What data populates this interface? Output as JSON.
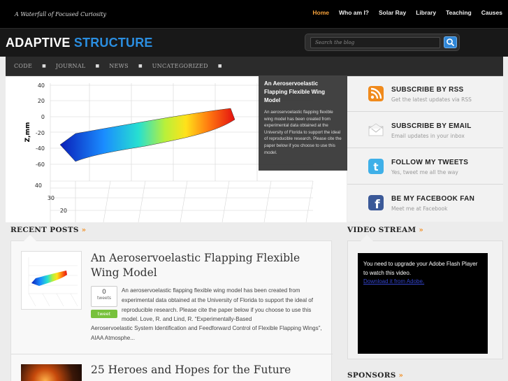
{
  "site": {
    "tagline": "A Waterfall of Focused Curiosity",
    "brand_part1": "ADAPTIVE",
    "brand_part2": "STRUCTURE"
  },
  "topnav": [
    "Home",
    "Who am I?",
    "Solar Ray",
    "Library",
    "Teaching",
    "Causes"
  ],
  "search": {
    "placeholder": "Search the blog",
    "button_icon": "search-icon"
  },
  "categories": [
    "CODE",
    "JOURNAL",
    "NEWS",
    "UNCATEGORIZED"
  ],
  "featured": {
    "title": "An Aeroservoelastic Flapping Flexible Wing Model",
    "body": "An aeroservoelastic flapping flexible wing model has been created from experimental data obtained at the University of Florida to support the ideal of reproducible research.  Please cite the paper below if you choose to use this model.",
    "plot_ylabel": "Z,mm",
    "plot_z_ticks": [
      "40",
      "20",
      "0",
      "-20",
      "-40",
      "-60"
    ],
    "plot_y_ticks": [
      "40",
      "30",
      "20"
    ]
  },
  "subscribe": [
    {
      "title": "SUBSCRIBE BY RSS",
      "subtitle": "Get the latest updates via RSS",
      "icon": "rss-icon",
      "color": "#f08a1c"
    },
    {
      "title": "SUBSCRIBE BY EMAIL",
      "subtitle": "Email updates in your inbox",
      "icon": "email-icon",
      "color": "#ffffff"
    },
    {
      "title": "FOLLOW MY TWEETS",
      "subtitle": "Yes, tweet me all the way",
      "icon": "twitter-icon",
      "color": "#3fb0e8"
    },
    {
      "title": "BE MY FACEBOOK FAN",
      "subtitle": "Meet me at Facebook",
      "icon": "facebook-icon",
      "color": "#3b5998"
    }
  ],
  "recent_posts": {
    "heading": "RECENT POSTS",
    "arrow": "»",
    "posts": [
      {
        "title": "An Aeroservoelastic Flapping Flexible Wing Model",
        "tweet_count": "0",
        "tweet_count_label": "tweets",
        "tweet_button": "tweet",
        "excerpt_a": "An aeroservoelastic flapping flexible wing model has been created from experimental data obtained at the University of Florida to support the ideal of reproducible research.  Please cite the paper below if you choose to use this model. Love, R. and Lind, R. “Experimentally-Based",
        "excerpt_b": "Aeroservoelastic System Identification and Feedforward Control of Flexible Flapping Wings”, AIAA Atmosphe..."
      },
      {
        "title": "25 Heroes and Hopes for the Future"
      }
    ]
  },
  "video": {
    "heading": "VIDEO STREAM",
    "arrow": "»",
    "message": "You need to upgrade your Adobe Flash Player to watch this video.",
    "link": "Download it from Adobe."
  },
  "sponsors": {
    "heading": "SPONSORS",
    "arrow": "»"
  },
  "colors": {
    "accent": "#f08a1c",
    "brand_blue": "#2b8ee0",
    "active_nav": "#f7a23a"
  }
}
